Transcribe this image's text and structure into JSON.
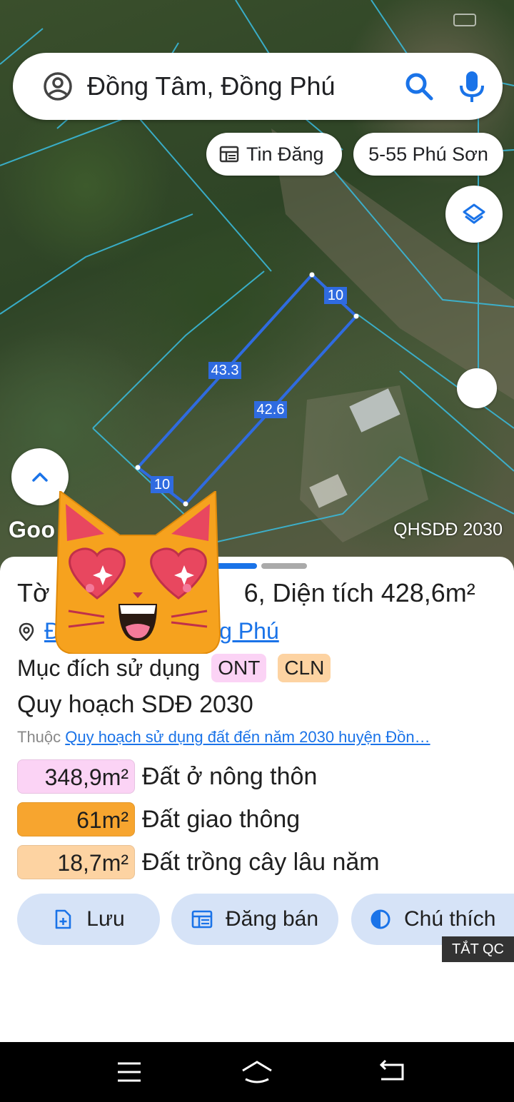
{
  "search": {
    "query": "Đồng Tâm, Đồng Phú"
  },
  "chips": {
    "news_label": "Tin Đăng",
    "place_label": "5-55 Phú Sơn"
  },
  "map": {
    "edge_labels": [
      "10",
      "43.3",
      "42.6",
      "10"
    ],
    "google_text": "Goo",
    "layer_label": "QHSDĐ 2030",
    "parcel_color": "#2f6be0"
  },
  "sheet": {
    "title": "Tờ 6, Diện tích 428,6m²",
    "title_left": "Tờ",
    "title_right": "6, Diện tích 428,6m²",
    "address_left": "Đ",
    "address_right": "g Phú",
    "purpose_label": "Mục đích sử dụng",
    "tags": [
      "ONT",
      "CLN"
    ],
    "plan_title": "Quy hoạch SDĐ 2030",
    "belongs_prefix": "Thuộc",
    "belongs_link": "Quy hoạch sử dụng đất đến năm 2030 huyện Đồn…",
    "areas": [
      {
        "value": "348,9m²",
        "name": "Đất ở nông thôn",
        "color": "#fbd3f5"
      },
      {
        "value": "61m²",
        "name": "Đất giao thông",
        "color": "#f7a52f"
      },
      {
        "value": "18,7m²",
        "name": "Đất trồng cây lâu năm",
        "color": "#fdd3a2"
      }
    ],
    "actions": {
      "save": "Lưu",
      "sell": "Đăng bán",
      "legend": "Chú thích"
    }
  },
  "ad": {
    "off_label": "TẮT QC"
  },
  "colors": {
    "accent": "#1a73e8",
    "button_bg": "#d6e3f7"
  }
}
